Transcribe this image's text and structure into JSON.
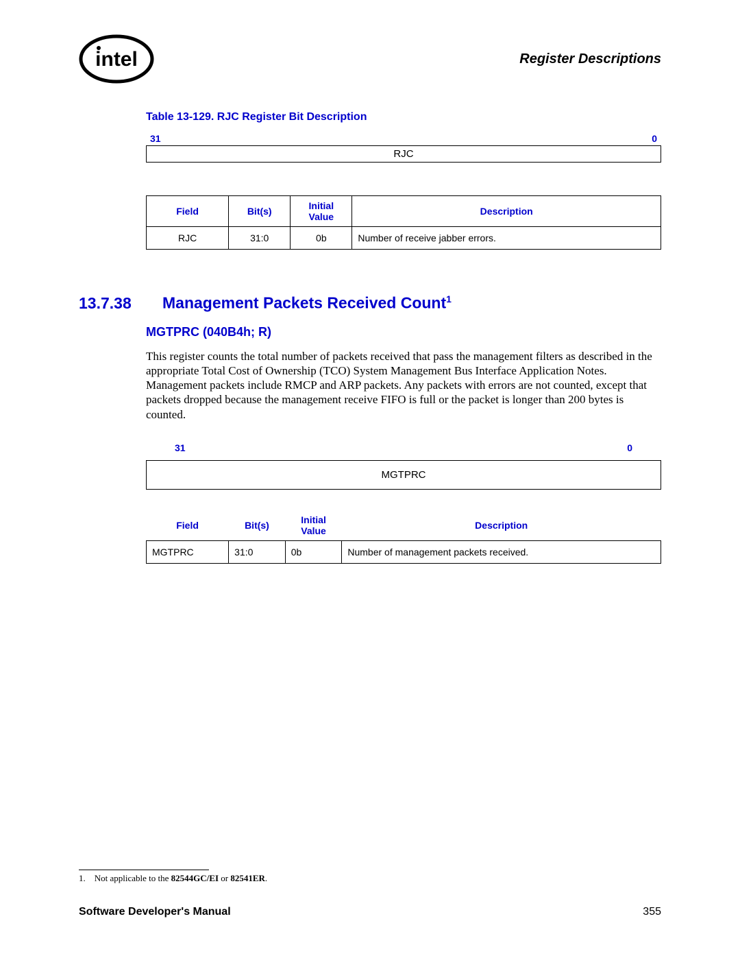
{
  "header": {
    "title": "Register Descriptions"
  },
  "table1": {
    "caption": "Table 13-129. RJC Register Bit Description",
    "bit_hi": "31",
    "bit_lo": "0",
    "bitbox_label": "RJC",
    "headers": {
      "field": "Field",
      "bits": "Bit(s)",
      "init": "Initial Value",
      "desc": "Description"
    },
    "rows": [
      {
        "field": "RJC",
        "bits": "31:0",
        "init": "0b",
        "desc": "Number of receive jabber errors."
      }
    ]
  },
  "section": {
    "number": "13.7.38",
    "title": "Management Packets Received Count",
    "sup": "1",
    "subhead": "MGTPRC (040B4h; R)",
    "para": "This register counts the total number of packets received that pass the management filters as described in the appropriate Total Cost of Ownership (TCO) System Management Bus Interface Application Notes. Management packets include RMCP and ARP packets. Any packets with errors are not counted, except that packets dropped because the management receive FIFO is full or the packet is longer than 200 bytes is counted."
  },
  "table2": {
    "bit_hi": "31",
    "bit_lo": "0",
    "bitbox_label": "MGTPRC",
    "headers": {
      "field": "Field",
      "bits": "Bit(s)",
      "init": "Initial Value",
      "desc": "Description"
    },
    "rows": [
      {
        "field": "MGTPRC",
        "bits": "31:0",
        "init": "0b",
        "desc": "Number of management packets received."
      }
    ]
  },
  "footnote": {
    "num": "1.",
    "text_prefix": "Not applicable to the ",
    "bold1": "82544GC/EI",
    "mid": " or ",
    "bold2": "82541ER",
    "suffix": "."
  },
  "footer": {
    "left": "Software Developer's Manual",
    "right": "355"
  }
}
